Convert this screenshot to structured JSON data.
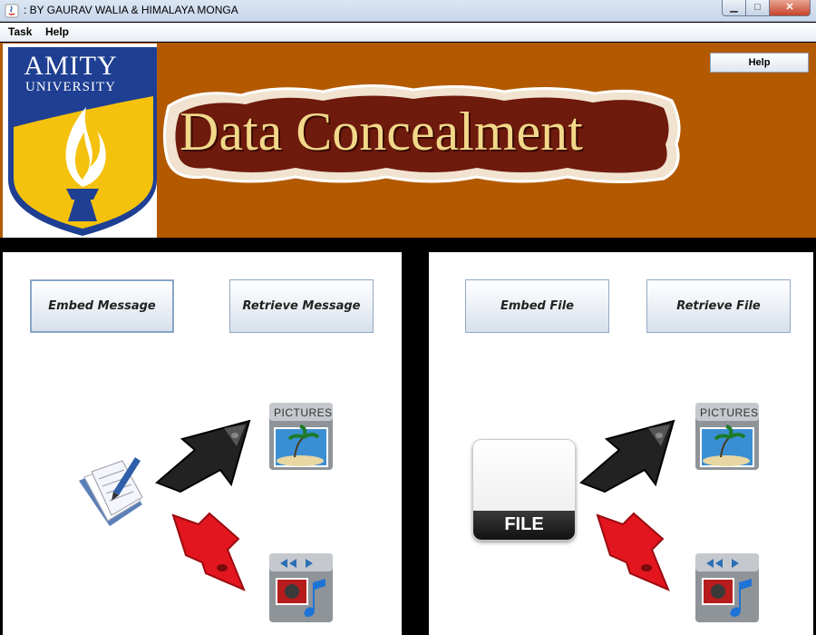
{
  "window": {
    "title": ": BY GAURAV WALIA & HIMALAYA MONGA",
    "min_icon": "minimize-icon",
    "max_icon": "maximize-icon",
    "close_icon": "close-icon"
  },
  "menubar": {
    "items": [
      "Task",
      "Help"
    ]
  },
  "header": {
    "logo_text_1": "AMITY",
    "logo_text_2": "UNIVERSITY",
    "title": "Data Concealment",
    "help_button": "Help",
    "colors": {
      "banner": "#b35a00",
      "logo_shield": "#1f3f93",
      "logo_yellow": "#f4c20d"
    }
  },
  "left_panel": {
    "embed_button": "Embed Message",
    "retrieve_button": "Retrieve Message",
    "source_icon": "document-pen-icon",
    "embed_arrow_icon": "black-cursor-arrow-icon",
    "retrieve_arrow_icon": "red-cursor-arrow-icon",
    "target_image_icon": "pictures-folder-icon",
    "target_media_icon": "media-folder-icon",
    "pictures_label": "PICTURES"
  },
  "right_panel": {
    "embed_button": "Embed File",
    "retrieve_button": "Retrieve File",
    "source_icon": "file-icon",
    "file_label": "FILE",
    "embed_arrow_icon": "black-cursor-arrow-icon",
    "retrieve_arrow_icon": "red-cursor-arrow-icon",
    "target_image_icon": "pictures-folder-icon",
    "target_media_icon": "media-folder-icon",
    "pictures_label": "PICTURES"
  }
}
